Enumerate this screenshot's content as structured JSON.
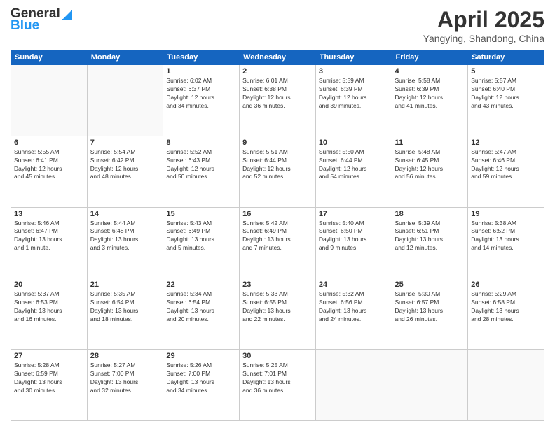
{
  "header": {
    "logo_general": "General",
    "logo_blue": "Blue",
    "month_title": "April 2025",
    "location": "Yangying, Shandong, China"
  },
  "days_of_week": [
    "Sunday",
    "Monday",
    "Tuesday",
    "Wednesday",
    "Thursday",
    "Friday",
    "Saturday"
  ],
  "weeks": [
    [
      {
        "day": "",
        "info": ""
      },
      {
        "day": "",
        "info": ""
      },
      {
        "day": "1",
        "info": "Sunrise: 6:02 AM\nSunset: 6:37 PM\nDaylight: 12 hours\nand 34 minutes."
      },
      {
        "day": "2",
        "info": "Sunrise: 6:01 AM\nSunset: 6:38 PM\nDaylight: 12 hours\nand 36 minutes."
      },
      {
        "day": "3",
        "info": "Sunrise: 5:59 AM\nSunset: 6:39 PM\nDaylight: 12 hours\nand 39 minutes."
      },
      {
        "day": "4",
        "info": "Sunrise: 5:58 AM\nSunset: 6:39 PM\nDaylight: 12 hours\nand 41 minutes."
      },
      {
        "day": "5",
        "info": "Sunrise: 5:57 AM\nSunset: 6:40 PM\nDaylight: 12 hours\nand 43 minutes."
      }
    ],
    [
      {
        "day": "6",
        "info": "Sunrise: 5:55 AM\nSunset: 6:41 PM\nDaylight: 12 hours\nand 45 minutes."
      },
      {
        "day": "7",
        "info": "Sunrise: 5:54 AM\nSunset: 6:42 PM\nDaylight: 12 hours\nand 48 minutes."
      },
      {
        "day": "8",
        "info": "Sunrise: 5:52 AM\nSunset: 6:43 PM\nDaylight: 12 hours\nand 50 minutes."
      },
      {
        "day": "9",
        "info": "Sunrise: 5:51 AM\nSunset: 6:44 PM\nDaylight: 12 hours\nand 52 minutes."
      },
      {
        "day": "10",
        "info": "Sunrise: 5:50 AM\nSunset: 6:44 PM\nDaylight: 12 hours\nand 54 minutes."
      },
      {
        "day": "11",
        "info": "Sunrise: 5:48 AM\nSunset: 6:45 PM\nDaylight: 12 hours\nand 56 minutes."
      },
      {
        "day": "12",
        "info": "Sunrise: 5:47 AM\nSunset: 6:46 PM\nDaylight: 12 hours\nand 59 minutes."
      }
    ],
    [
      {
        "day": "13",
        "info": "Sunrise: 5:46 AM\nSunset: 6:47 PM\nDaylight: 13 hours\nand 1 minute."
      },
      {
        "day": "14",
        "info": "Sunrise: 5:44 AM\nSunset: 6:48 PM\nDaylight: 13 hours\nand 3 minutes."
      },
      {
        "day": "15",
        "info": "Sunrise: 5:43 AM\nSunset: 6:49 PM\nDaylight: 13 hours\nand 5 minutes."
      },
      {
        "day": "16",
        "info": "Sunrise: 5:42 AM\nSunset: 6:49 PM\nDaylight: 13 hours\nand 7 minutes."
      },
      {
        "day": "17",
        "info": "Sunrise: 5:40 AM\nSunset: 6:50 PM\nDaylight: 13 hours\nand 9 minutes."
      },
      {
        "day": "18",
        "info": "Sunrise: 5:39 AM\nSunset: 6:51 PM\nDaylight: 13 hours\nand 12 minutes."
      },
      {
        "day": "19",
        "info": "Sunrise: 5:38 AM\nSunset: 6:52 PM\nDaylight: 13 hours\nand 14 minutes."
      }
    ],
    [
      {
        "day": "20",
        "info": "Sunrise: 5:37 AM\nSunset: 6:53 PM\nDaylight: 13 hours\nand 16 minutes."
      },
      {
        "day": "21",
        "info": "Sunrise: 5:35 AM\nSunset: 6:54 PM\nDaylight: 13 hours\nand 18 minutes."
      },
      {
        "day": "22",
        "info": "Sunrise: 5:34 AM\nSunset: 6:54 PM\nDaylight: 13 hours\nand 20 minutes."
      },
      {
        "day": "23",
        "info": "Sunrise: 5:33 AM\nSunset: 6:55 PM\nDaylight: 13 hours\nand 22 minutes."
      },
      {
        "day": "24",
        "info": "Sunrise: 5:32 AM\nSunset: 6:56 PM\nDaylight: 13 hours\nand 24 minutes."
      },
      {
        "day": "25",
        "info": "Sunrise: 5:30 AM\nSunset: 6:57 PM\nDaylight: 13 hours\nand 26 minutes."
      },
      {
        "day": "26",
        "info": "Sunrise: 5:29 AM\nSunset: 6:58 PM\nDaylight: 13 hours\nand 28 minutes."
      }
    ],
    [
      {
        "day": "27",
        "info": "Sunrise: 5:28 AM\nSunset: 6:59 PM\nDaylight: 13 hours\nand 30 minutes."
      },
      {
        "day": "28",
        "info": "Sunrise: 5:27 AM\nSunset: 7:00 PM\nDaylight: 13 hours\nand 32 minutes."
      },
      {
        "day": "29",
        "info": "Sunrise: 5:26 AM\nSunset: 7:00 PM\nDaylight: 13 hours\nand 34 minutes."
      },
      {
        "day": "30",
        "info": "Sunrise: 5:25 AM\nSunset: 7:01 PM\nDaylight: 13 hours\nand 36 minutes."
      },
      {
        "day": "",
        "info": ""
      },
      {
        "day": "",
        "info": ""
      },
      {
        "day": "",
        "info": ""
      }
    ]
  ]
}
